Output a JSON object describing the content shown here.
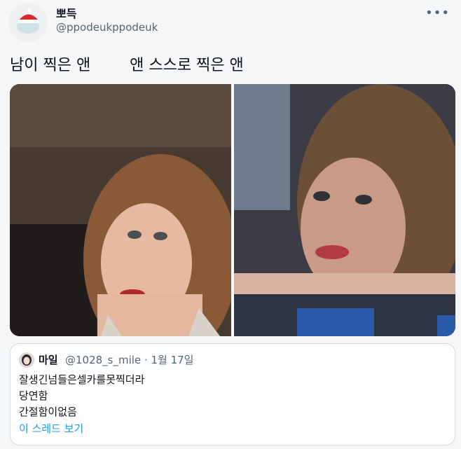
{
  "author": {
    "display_name": "뽀득",
    "handle": "@ppodeukppodeuk"
  },
  "tweet": {
    "text_left": "남이 찍은 앤",
    "text_right": "앤 스스로 찍은 앤"
  },
  "media": {
    "left_alt": "photo",
    "right_alt": "photo"
  },
  "quoted_tweet": {
    "display_name": "마일",
    "handle_date": "@1028_s_mile · 1월 17일",
    "lines": [
      "잘생긴넘들은셀카를못찍더라",
      "당연함",
      "간절함이없음"
    ],
    "thread_link": "이 스레드 보기"
  },
  "icons": {
    "more": "more-horizontal-icon"
  },
  "colors": {
    "accent": "#1d9bf0",
    "secondary_text": "#536471"
  }
}
